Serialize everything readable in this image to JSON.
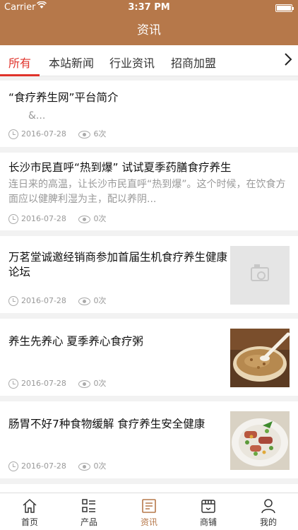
{
  "status_bar": {
    "carrier": "Carrier",
    "time": "3:37 PM"
  },
  "header": {
    "title": "资讯"
  },
  "tabs": [
    {
      "label": "所有",
      "active": true
    },
    {
      "label": "本站新闻",
      "active": false
    },
    {
      "label": "行业资讯",
      "active": false
    },
    {
      "label": "招商加盟",
      "active": false
    }
  ],
  "articles": [
    {
      "title": "“食疗养生网”平台简介",
      "summary": "&...",
      "date": "2016-07-28",
      "views": "6次",
      "thumbnail": "none"
    },
    {
      "title": "长沙市民直呼“热到爆” 试试夏季药膳食疗养生",
      "summary": "连日来的高温，让长沙市民直呼“热到爆”。这个时候，在饮食方面应以健脾利湿为主，配以养阴...",
      "date": "2016-07-28",
      "views": "0次",
      "thumbnail": "none"
    },
    {
      "title": "万茗堂诚邀经销商参加首届生机食疗养生健康论坛",
      "summary": "",
      "date": "2016-07-28",
      "views": "0次",
      "thumbnail": "camera-placeholder-icon"
    },
    {
      "title": "养生先养心 夏季养心食疗粥",
      "summary": "",
      "date": "2016-07-28",
      "views": "0次",
      "thumbnail": "porridge-bowl-photo"
    },
    {
      "title": "肠胃不好7种食物缓解 食疗养生安全健康",
      "summary": "",
      "date": "2016-07-28",
      "views": "0次",
      "thumbnail": "sausage-peas-dish-photo"
    }
  ],
  "tabbar": [
    {
      "label": "首页",
      "icon": "home-icon",
      "active": false
    },
    {
      "label": "产品",
      "icon": "product-grid-icon",
      "active": false
    },
    {
      "label": "资讯",
      "icon": "news-icon",
      "active": true
    },
    {
      "label": "商铺",
      "icon": "shop-icon",
      "active": false
    },
    {
      "label": "我的",
      "icon": "user-icon",
      "active": false
    }
  ],
  "colors": {
    "header_bg": "#b6784a",
    "active_tab": "#e0332b",
    "active_tabbar": "#b6784a",
    "meta_gray": "#999999"
  }
}
